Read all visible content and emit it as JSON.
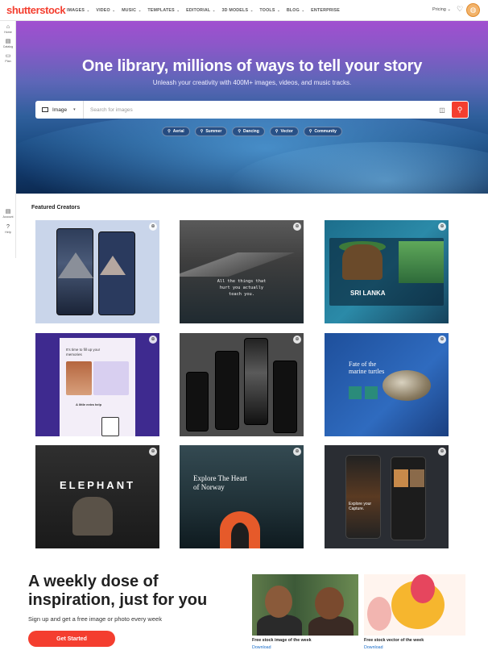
{
  "header": {
    "logo": "shutterstock",
    "nav": [
      {
        "label": "IMAGES",
        "chevron": "⌄"
      },
      {
        "label": "VIDEO",
        "chevron": "⌄"
      },
      {
        "label": "MUSIC",
        "chevron": "⌄"
      },
      {
        "label": "TEMPLATES",
        "chevron": "⌄"
      },
      {
        "label": "EDITORIAL",
        "chevron": "⌄"
      },
      {
        "label": "3D MODELS",
        "chevron": "⌄"
      },
      {
        "label": "TOOLS",
        "chevron": "⌄"
      },
      {
        "label": "BLOG",
        "chevron": "⌄"
      },
      {
        "label": "ENTERPRISE",
        "chevron": ""
      }
    ],
    "pricing": "Pricing ⌄",
    "heart_icon": "♡",
    "globe_icon": "◍"
  },
  "sidebar": {
    "items": [
      {
        "label": "Home",
        "icon": "⌂"
      },
      {
        "label": "Catalog",
        "icon": "▤"
      },
      {
        "label": "Plan",
        "icon": "▭"
      },
      {
        "label": "Account",
        "icon": "▤"
      },
      {
        "label": "Help",
        "icon": "?"
      }
    ]
  },
  "hero": {
    "title": "One library, millions of ways to tell your story",
    "subtitle": "Unleash your creativity with 400M+ images, videos, and music tracks.",
    "search": {
      "type": "Image",
      "placeholder": "Search for images",
      "camera_icon": "◫",
      "search_icon": "⚲"
    },
    "chips": [
      "Aerial",
      "Summer",
      "Dancing",
      "Vector",
      "Community"
    ]
  },
  "featured": {
    "title": "Featured Creators",
    "cards": {
      "quote": "All the things that\nhurt you actually\nteach you.",
      "sri_lanka": "SRI LANKA",
      "memories": "It's time to fill up your memories",
      "little_help": "A little extra help",
      "turtles": "Fate of the\nmarine turtles",
      "elephant": "ELEPHANT",
      "norway": "Explore The Heart\nof Norway",
      "pets": "Explore your Capture."
    },
    "zoom_icon": "⊕"
  },
  "weekly": {
    "title": "A weekly dose of inspiration, just for you",
    "subtitle": "Sign up and get a free image or photo every week",
    "button": "Get Started",
    "free_image": {
      "caption": "Free stock image of the week",
      "link": "Download"
    },
    "free_vector": {
      "caption": "Free stock vector of the week",
      "link": "Download"
    }
  }
}
